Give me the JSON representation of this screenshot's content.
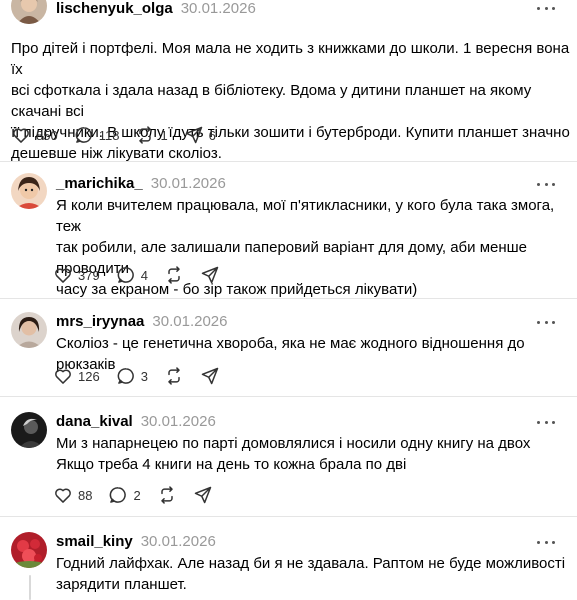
{
  "posts": [
    {
      "username": "lischenyuk_olga",
      "date": "30.01.2026",
      "text": "Про дітей і портфелі. Моя мала не ходить з книжками до школи. 1 вересня вона їх\nвсі сфоткала і здала назад в бібліотеку. Вдома у дитини планшет на якому скачані всі\nїї підручники. В школу їдуть тільки зошити і бутерброди. Купити планшет значно\nдешевше ніж лікувати сколіоз.",
      "likes": "850",
      "replies": "118",
      "reposts": "1",
      "shares": "6"
    },
    {
      "username": "_marichika_",
      "date": "30.01.2026",
      "text": "Я коли вчителем працювала, мої п'ятикласники, у кого була така змога, теж\nтак робили, але залишали паперовий варіант для дому, аби менше проводити\nчасу за екраном - бо зір також прийдеться лікувати)",
      "likes": "379",
      "replies": "4",
      "reposts": "",
      "shares": ""
    },
    {
      "username": "mrs_iryynaa",
      "date": "30.01.2026",
      "text": "Сколіоз - це генетична хвороба, яка не має жодного відношення до рюкзаків",
      "likes": "126",
      "replies": "3",
      "reposts": "",
      "shares": ""
    },
    {
      "username": "dana_kival",
      "date": "30.01.2026",
      "text": "Ми з напарнецею по парті домовлялися і носили одну книгу на двох\nЯкщо треба 4 книги на день то кожна брала по дві",
      "likes": "88",
      "replies": "2",
      "reposts": "",
      "shares": ""
    },
    {
      "username": "smail_kiny",
      "date": "30.01.2026",
      "text": "Годний лайфхак. Але назад би я не здавала. Раптом не буде можливості\nзарядити планшет.",
      "likes": "",
      "replies": "",
      "reposts": "",
      "shares": ""
    }
  ],
  "icons": {
    "like": "heart-icon",
    "reply": "comment-icon",
    "repost": "repost-icon",
    "share": "share-icon",
    "more": "more-icon"
  },
  "colors": {
    "date": "#999999",
    "separator": "#e5e5e5",
    "icon": "#333333"
  }
}
